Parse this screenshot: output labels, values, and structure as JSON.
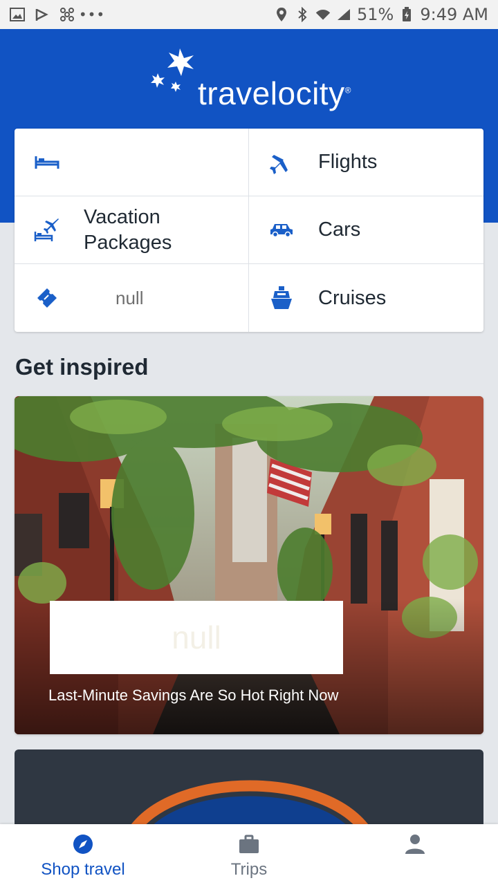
{
  "status_bar": {
    "battery": "51%",
    "time": "9:49 AM",
    "icons": [
      "image-icon",
      "check-flag-icon",
      "fan-icon",
      "more-dots-icon",
      "location-icon",
      "bluetooth-icon",
      "wifi-icon",
      "signal-icon",
      "battery-icon"
    ]
  },
  "header": {
    "brand": "travelocity",
    "reg_mark": "®"
  },
  "products": [
    {
      "label": "",
      "icon": "bed-icon"
    },
    {
      "label": "Flights",
      "icon": "plane-icon"
    },
    {
      "label": "Vacation\nPackages",
      "icon": "bed-plane-icon"
    },
    {
      "label": "Cars",
      "icon": "car-icon"
    },
    {
      "label": "null",
      "icon": "ticket-icon"
    },
    {
      "label": "Cruises",
      "icon": "ship-icon"
    }
  ],
  "inspired": {
    "title": "Get inspired",
    "card_overlay": "null",
    "card_caption": "Last-Minute Savings Are So Hot Right Now"
  },
  "bottom_nav": [
    {
      "label": "Shop travel",
      "icon": "compass-icon",
      "active": true
    },
    {
      "label": "Trips",
      "icon": "briefcase-icon",
      "active": false
    },
    {
      "label": "",
      "icon": "person-icon",
      "active": false
    }
  ],
  "colors": {
    "brand_blue": "#1153c3",
    "icon_blue": "#1a5fc8",
    "background": "#e4e7eb"
  }
}
